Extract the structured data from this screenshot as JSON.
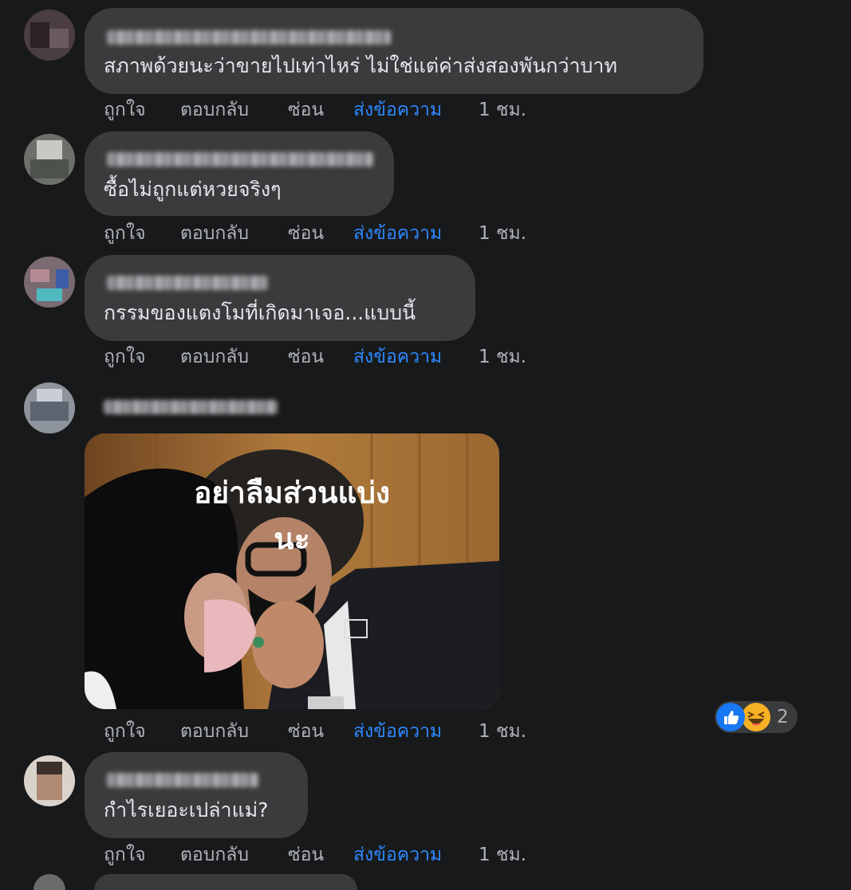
{
  "actions": {
    "like": "ถูกใจ",
    "reply": "ตอบกลับ",
    "hide": "ซ่อน",
    "message": "ส่งข้อความ"
  },
  "comments": [
    {
      "text": "สภาพด้วยนะว่าขายไปเท่าไหร่ ไม่ใช่แต่ค่าส่งสองพันกว่าบาท",
      "time": "1 ชม."
    },
    {
      "text": "ซื้อไม่ถูกแต่หวยจริงๆ",
      "time": "1 ชม."
    },
    {
      "text": "กรรมของแตงโมที่เกิดมาเจอ...แบบนี้",
      "time": "1 ชม."
    },
    {
      "time": "1 ชม.",
      "image_text": [
        "อย่าลืมส่วนแบ่ง",
        "นะ"
      ],
      "reactions": {
        "icons": [
          "like-icon",
          "haha-icon"
        ],
        "count": "2"
      }
    },
    {
      "text": "กำไรเยอะเปล่าแม่?",
      "time": "1 ชม."
    }
  ],
  "colors": {
    "background": "#18191a",
    "bubble": "#3a3b3c",
    "text": "#e4e6eb",
    "secondary": "#b0b3b8",
    "link": "#2d88ff"
  }
}
